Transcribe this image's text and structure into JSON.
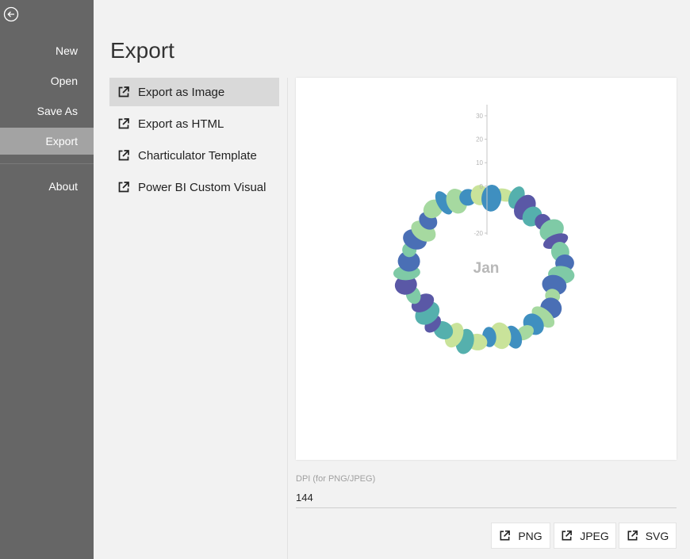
{
  "nav": {
    "back_icon": "back-arrow-icon",
    "items": [
      {
        "label": "New"
      },
      {
        "label": "Open"
      },
      {
        "label": "Save As"
      },
      {
        "label": "Export"
      },
      {
        "label": "About"
      }
    ],
    "active": "Export",
    "colors": {
      "background": "#666666",
      "active": "#a3a3a3"
    }
  },
  "page": {
    "title": "Export"
  },
  "export_options": [
    {
      "label": "Export as Image",
      "icon": "external-link-icon",
      "selected": true
    },
    {
      "label": "Export as HTML",
      "icon": "external-link-icon",
      "selected": false
    },
    {
      "label": "Charticulator Template",
      "icon": "external-link-icon",
      "selected": false
    },
    {
      "label": "Power BI Custom Visual",
      "icon": "external-link-icon",
      "selected": false
    }
  ],
  "preview": {
    "center_label": "Jan",
    "chart_data": {
      "type": "scatter",
      "layout": "polar",
      "axis": {
        "ticks": [
          "30",
          "20",
          "10",
          "0",
          "-20"
        ],
        "range": [
          -20,
          30
        ]
      },
      "petal_count": 40,
      "palette": [
        "#c9e39a",
        "#a6d9a0",
        "#7fcaa6",
        "#55b0ad",
        "#3f8fc0",
        "#4a6fb5",
        "#5a58a6"
      ]
    }
  },
  "dpi": {
    "label": "DPI (for PNG/JPEG)",
    "value": "144"
  },
  "buttons": [
    {
      "label": "PNG",
      "icon": "external-link-icon"
    },
    {
      "label": "JPEG",
      "icon": "external-link-icon"
    },
    {
      "label": "SVG",
      "icon": "external-link-icon"
    }
  ]
}
